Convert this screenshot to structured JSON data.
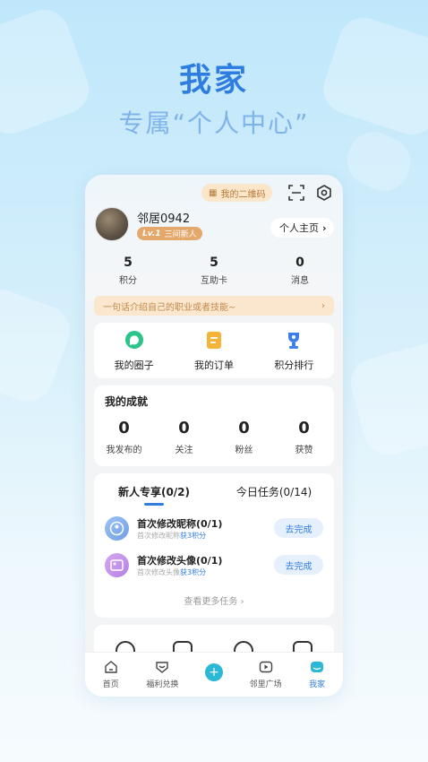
{
  "hero": {
    "title": "我家",
    "subtitle": "专属“个人中心”"
  },
  "header": {
    "qr_label": "我的二维码",
    "scan_icon": "scan-icon",
    "settings_icon": "settings-icon"
  },
  "profile": {
    "nickname": "邻居0942",
    "level_tag": "Lv.1",
    "level_name": "三间新人",
    "homepage_label": "个人主页"
  },
  "stats": [
    {
      "value": "5",
      "label": "积分"
    },
    {
      "value": "5",
      "label": "互助卡"
    },
    {
      "value": "0",
      "label": "消息"
    }
  ],
  "intro": {
    "text": "一句话介绍自己的职业或者技能~"
  },
  "shortcuts": [
    {
      "label": "我的圈子",
      "icon": "circle-icon",
      "color": "#2bc48a"
    },
    {
      "label": "我的订单",
      "icon": "order-icon",
      "color": "#f5b33a"
    },
    {
      "label": "积分排行",
      "icon": "trophy-icon",
      "color": "#3c7fe6"
    }
  ],
  "achievements": {
    "title": "我的成就",
    "items": [
      {
        "value": "0",
        "label": "我发布的"
      },
      {
        "value": "0",
        "label": "关注"
      },
      {
        "value": "0",
        "label": "粉丝"
      },
      {
        "value": "0",
        "label": "获赞"
      }
    ]
  },
  "tasks": {
    "tabs": [
      {
        "label": "新人专享(0/2)"
      },
      {
        "label": "今日任务(0/14)"
      }
    ],
    "items": [
      {
        "title": "首次修改昵称(0/1)",
        "desc": "首次修改昵称",
        "reward": "获3积分",
        "action": "去完成"
      },
      {
        "title": "首次修改头像(0/1)",
        "desc": "首次修改头像",
        "reward": "获3积分",
        "action": "去完成"
      }
    ],
    "more": "查看更多任务 ›"
  },
  "tabbar": [
    {
      "label": "首页",
      "icon": "home-icon"
    },
    {
      "label": "福利兑换",
      "icon": "gift-icon"
    },
    {
      "label": "",
      "icon": "plus-icon"
    },
    {
      "label": "邻里广场",
      "icon": "video-square-icon"
    },
    {
      "label": "我家",
      "icon": "my-home-icon"
    }
  ],
  "colors": {
    "accent": "#2f7de1",
    "chip_bg": "#fbe7cd",
    "chip_text": "#c0894d"
  }
}
